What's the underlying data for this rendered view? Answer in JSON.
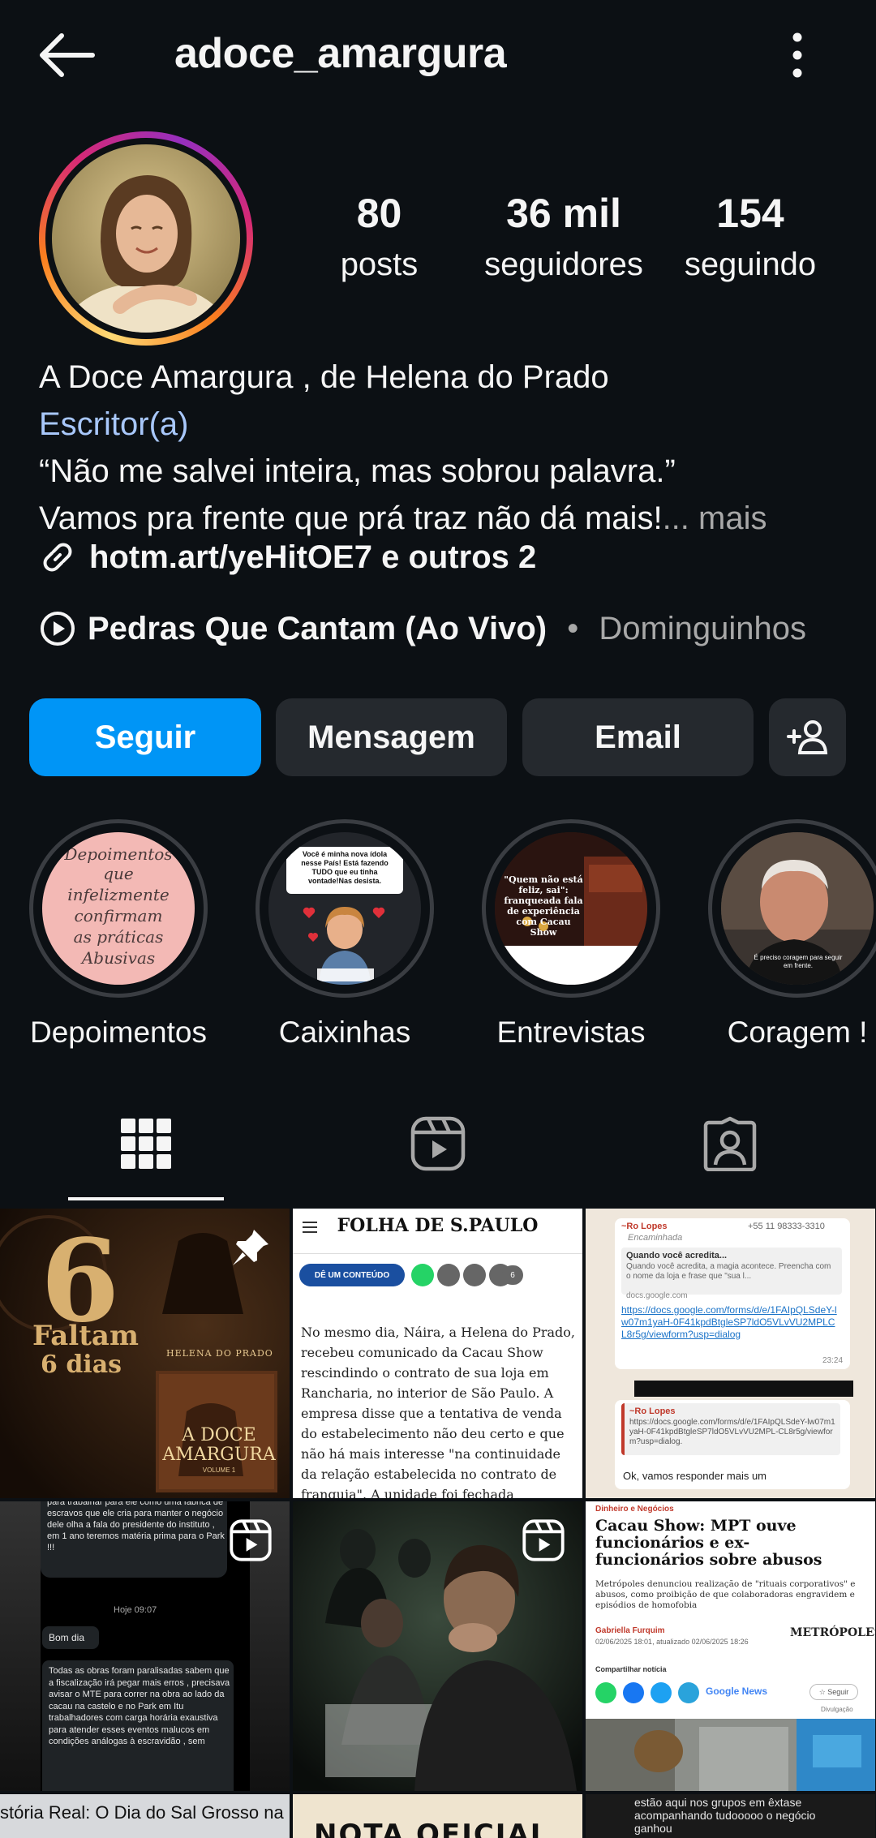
{
  "header": {
    "username": "adoce_amargura"
  },
  "stats": {
    "posts_count": "80",
    "posts_label": "posts",
    "followers_count": "36 mil",
    "followers_label": "seguidores",
    "following_count": "154",
    "following_label": "seguindo"
  },
  "bio": {
    "name": "A Doce Amargura , de Helena do Prado",
    "category": "Escritor(a)",
    "line1": "“Não me salvei inteira, mas sobrou palavra.”",
    "line2": "Vamos pra frente que prá traz não dá mais!",
    "more": "... mais",
    "link": "hotm.art/yeHitOE7 e outros 2"
  },
  "music": {
    "song": "Pedras Que Cantam (Ao Vivo)",
    "separator": " • ",
    "artist": "Dominguinhos"
  },
  "actions": {
    "follow": "Seguir",
    "message": "Mensagem",
    "email": "Email"
  },
  "highlights": [
    {
      "label": "Depoimentos",
      "cover_text": [
        "Depoimentos",
        "que",
        "infelizmente",
        "confirmam",
        "as práticas",
        "Abusivas"
      ]
    },
    {
      "label": "Caixinhas",
      "cover_text": "Você é minha nova ídola nesse País! Está fazendo TUDO que eu tinha vontade!Nas desista."
    },
    {
      "label": "Entrevistas",
      "cover_text": "\"Quem não está feliz, sai\": franqueada fala de experiência com Cacau Show"
    },
    {
      "label": "Coragem !",
      "cover_text": "É preciso coragem para seguir em frente."
    }
  ],
  "grid": {
    "post1": {
      "big": "6",
      "line1": "Faltam",
      "line2": "6 dias",
      "author": "HELENA DO PRADO",
      "book_title_1": "A DOCE",
      "book_title_2": "AMARGURA",
      "volume": "VOLUME 1"
    },
    "post2": {
      "masthead": "FOLHA DE S.PAULO",
      "pill": "DÊ UM CONTEÚDO",
      "count": "6",
      "body": "No mesmo dia, Náira, a Helena do Prado, recebeu comunicado da Cacau Show rescindindo o contrato de sua loja em Rancharia, no interior de São Paulo. A empresa disse que a tentativa de venda do estabelecimento não deu certo e que não há mais interesse \"na continuidade da relação estabelecida no contrato de franquia\". A unidade foi fechada"
    },
    "post3": {
      "sender": "~Ro Lopes",
      "phone": "+55 11 98333-3310",
      "forwarded": "Encaminhada",
      "q1": "Quando você acredita...",
      "q2": "Quando você acredita, a magia acontece. Preencha com o nome da loja e frase que \"sua l...",
      "domain": "docs.google.com",
      "url": "https://docs.google.com/forms/d/e/1FAIpQLSdeY-lw07m1yaH-0F41kpdBtgleSP7ldO5VLvVU2MPLCL8r5g/viewform?usp=dialog",
      "time": "23:24",
      "reply_sender": "~Ro Lopes",
      "reply_url": "https://docs.google.com/forms/d/e/1FAIpQLSdeY-lw07m1yaH-0F41kpdBtgleSP7ldO5VLvVU2MPL-CL8r5g/viewform?usp=dialog.",
      "reply_msg": "Ok, vamos responder mais um"
    },
    "post4": {
      "top_text": "para trabalhar para ele como uma fábrica de escravos que ele cria para manter o negócio dele olha a fala do presidente do instituto , em 1 ano teremos matéria prima para o Park !!!",
      "time": "Hoje 09:07",
      "greeting": "Bom dia",
      "msg": "Todas as obras foram paralisadas sabem que a fiscalização irá pegar mais erros , precisava avisar o MTE para correr na obra ao lado da cacau na castelo e no Park em Itu trabalhadores com carga horária exaustiva para atender esses eventos malucos em condições análogas à escravidão , sem"
    },
    "post6": {
      "section": "Dinheiro e Negócios",
      "headline": "Cacau Show: MPT ouve funcionários e ex-funcionários sobre abusos",
      "dek": "Metrópoles denunciou realização de \"rituais corporativos\" e abusos, como proibição de que colaboradoras engravidem e episódios de homofobia",
      "author": "Gabriella Furquim",
      "date": "02/06/2025 18:01, atualizado 02/06/2025 18:26",
      "brand": "METRÓPOLES",
      "share": "Compartilhar notícia",
      "gnews": "Google News",
      "follow": "☆ Seguir",
      "credit": "Divulgação"
    },
    "row3": {
      "left": "stória Real: O Dia do Sal Grosso na",
      "mid": "NOTA OFICIAL",
      "right": "estão aqui nos grupos em êxtase acompanhando tudooooo o negócio ganhou"
    }
  },
  "colors": {
    "background": "#0c1014",
    "button": "#25292e",
    "follow_button": "#0095f6",
    "category": "#a8c7fa",
    "muted": "#a8a8a8"
  },
  "icons": [
    "back-arrow-icon",
    "more-options-icon",
    "link-icon",
    "play-circle-icon",
    "add-person-icon",
    "grid-icon",
    "reels-icon",
    "tagged-icon",
    "pin-icon",
    "reel-badge-icon"
  ]
}
